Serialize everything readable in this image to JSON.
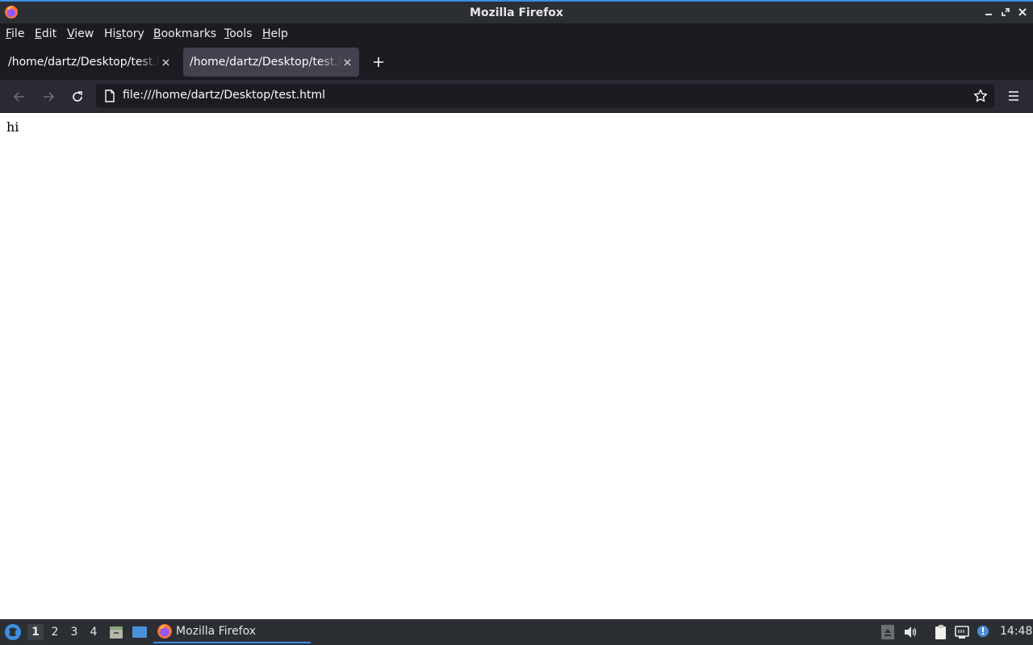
{
  "window": {
    "title": "Mozilla Firefox"
  },
  "menubar": {
    "items": [
      {
        "pre": "",
        "u": "F",
        "post": "ile"
      },
      {
        "pre": "",
        "u": "E",
        "post": "dit"
      },
      {
        "pre": "",
        "u": "V",
        "post": "iew"
      },
      {
        "pre": "Hi",
        "u": "s",
        "post": "tory"
      },
      {
        "pre": "",
        "u": "B",
        "post": "ookmarks"
      },
      {
        "pre": "",
        "u": "T",
        "post": "ools"
      },
      {
        "pre": "",
        "u": "H",
        "post": "elp"
      }
    ]
  },
  "tabs": [
    {
      "label": "/home/dartz/Desktop/test.html",
      "active": false
    },
    {
      "label": "/home/dartz/Desktop/test.html",
      "active": true
    }
  ],
  "urlbar": {
    "url": "file:///home/dartz/Desktop/test.html"
  },
  "page": {
    "body_text": "hi"
  },
  "taskbar": {
    "workspaces": [
      "1",
      "2",
      "3",
      "4"
    ],
    "active_workspace": "1",
    "task_label": "Mozilla Firefox",
    "clock": "14:48"
  },
  "colors": {
    "titlebar": "#2b2e33",
    "menubar": "#1c1b22",
    "active_tab": "#42414d",
    "navbar": "#2b2a33",
    "accent": "#3d8ee0"
  },
  "icons": [
    "firefox-icon",
    "minimize-icon",
    "maximize-icon",
    "close-icon",
    "back-arrow-icon",
    "forward-arrow-icon",
    "reload-icon",
    "page-icon",
    "bookmark-star-icon",
    "hamburger-menu-icon",
    "plus-icon",
    "start-menu-icon",
    "file-manager-icon",
    "desktop-icon",
    "eject-icon",
    "volume-icon",
    "clipboard-icon",
    "network-icon",
    "notification-icon"
  ]
}
